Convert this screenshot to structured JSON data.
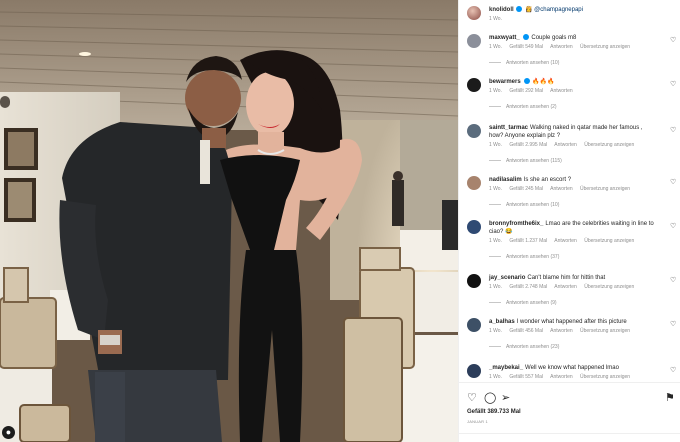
{
  "post": {
    "author": "knolidoll",
    "author_emoji": "👸",
    "mention": "@champagnepapi",
    "time": "1 Wo.",
    "likes": "Gefällt 389.733 Mal",
    "date": "JANUAR 1"
  },
  "icons": {
    "like": "heart-icon",
    "comment": "comment-icon",
    "share": "paper-plane-icon",
    "save": "bookmark-icon",
    "comment_like": "heart-outline-icon",
    "photo_user": "user-tag-icon"
  },
  "comments": [
    {
      "user": "maxwyatt_",
      "verified": true,
      "text": "Couple goals m8",
      "time": "1 Wo.",
      "likes": "Gefällt 549 Mal",
      "reply": "Antworten",
      "translate": "Übersetzung anzeigen",
      "replies": "Antworten ansehen (10)",
      "avatar_color": "#8b8f9a"
    },
    {
      "user": "bewarmers",
      "verified": true,
      "text": "🔥🔥🔥",
      "time": "1 Wo.",
      "likes": "Gefällt 292 Mal",
      "reply": "Antworten",
      "translate": "",
      "replies": "Antworten ansehen (2)",
      "avatar_color": "#1b1b1b"
    },
    {
      "user": "saintt_tarmac",
      "verified": false,
      "text": "Walking naked in qatar made her famous , how? Anyone explain plz ?",
      "time": "1 Wo.",
      "likes": "Gefällt 2.995 Mal",
      "reply": "Antworten",
      "translate": "Übersetzung anzeigen",
      "replies": "Antworten ansehen (115)",
      "avatar_color": "#5b6c7d"
    },
    {
      "user": "nadilasalim",
      "verified": false,
      "text": "Is she an escort ?",
      "time": "1 Wo.",
      "likes": "Gefällt 245 Mal",
      "reply": "Antworten",
      "translate": "Übersetzung anzeigen",
      "replies": "Antworten ansehen (10)",
      "avatar_color": "#a7836d"
    },
    {
      "user": "bronnyfromthe6ix_",
      "verified": false,
      "text": "Lmao are the celebrities waiting in line to ciao? 😂",
      "time": "1 Wo.",
      "likes": "Gefällt 1.237 Mal",
      "reply": "Antworten",
      "translate": "Übersetzung anzeigen",
      "replies": "Antworten ansehen (37)",
      "avatar_color": "#2f4a73"
    },
    {
      "user": "jay_scenario",
      "verified": false,
      "text": "Can't blame him for hittin that",
      "time": "1 Wo.",
      "likes": "Gefällt 2.748 Mal",
      "reply": "Antworten",
      "translate": "Übersetzung anzeigen",
      "replies": "Antworten ansehen (9)",
      "avatar_color": "#111111"
    },
    {
      "user": "a_balhas",
      "verified": false,
      "text": "I wonder what happened after this picture",
      "time": "1 Wo.",
      "likes": "Gefällt 456 Mal",
      "reply": "Antworten",
      "translate": "Übersetzung anzeigen",
      "replies": "Antworten ansehen (23)",
      "avatar_color": "#3d5066"
    },
    {
      "user": "_maybekai_",
      "verified": false,
      "text": "Well we know what happened lmao",
      "time": "1 Wo.",
      "likes": "Gefällt 557 Mal",
      "reply": "Antworten",
      "translate": "Übersetzung anzeigen",
      "replies": "",
      "avatar_color": "#2c3d5a"
    }
  ]
}
